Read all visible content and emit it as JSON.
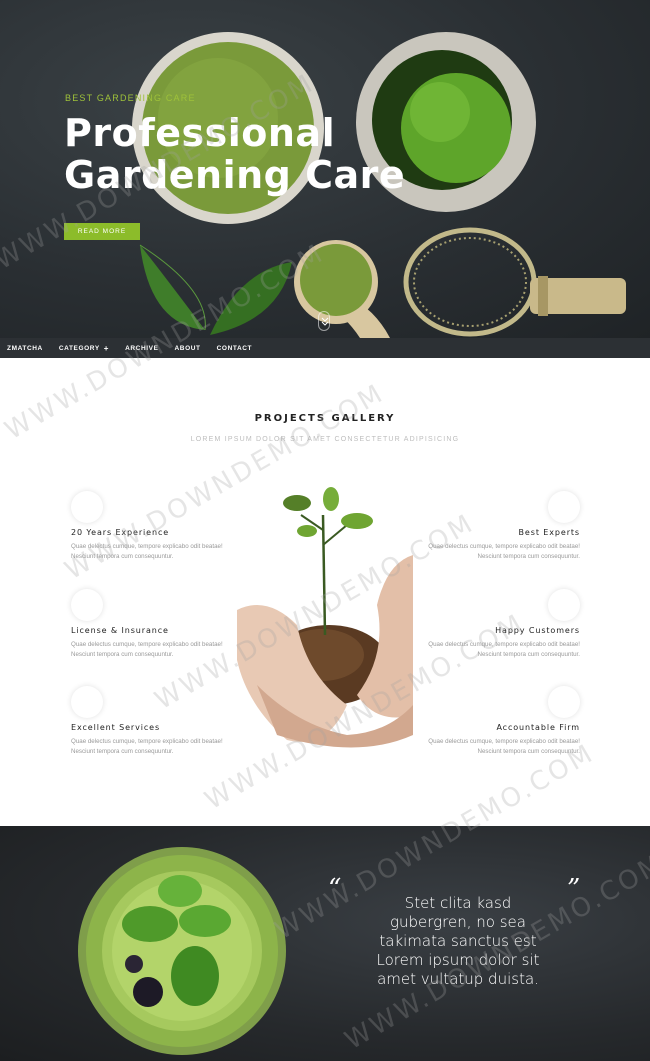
{
  "hero": {
    "kicker": "BEST GARDENING CARE",
    "title": "Professional Gardening Care",
    "button_label": "READ MORE"
  },
  "nav": {
    "items": [
      "ZMATCHA",
      "CATEGORY",
      "ARCHIVE",
      "ABOUT",
      "CONTACT"
    ],
    "category_expand": "+"
  },
  "gallery": {
    "title": "PROJECTS GALLERY",
    "subtitle": "LOREM IPSUM DOLOR SIT AMET CONSECTETUR ADIPISICING",
    "features_left": [
      {
        "title": "20 Years Experience",
        "text": "Quae delectus cumque, tempore explicabo odit beatae! Nesciunt tempora cum consequuntur."
      },
      {
        "title": "License & Insurance",
        "text": "Quae delectus cumque, tempore explicabo odit beatae! Nesciunt tempora cum consequuntur."
      },
      {
        "title": "Excellent Services",
        "text": "Quae delectus cumque, tempore explicabo odit beatae! Nesciunt tempora cum consequuntur."
      }
    ],
    "features_right": [
      {
        "title": "Best Experts",
        "text": "Quae delectus cumque, tempore explicabo odit beatae! Nesciunt tempora cum consequuntur."
      },
      {
        "title": "Happy Customers",
        "text": "Quae delectus cumque, tempore explicabo odit beatae! Nesciunt tempora cum consequuntur."
      },
      {
        "title": "Accountable Firm",
        "text": "Quae delectus cumque, tempore explicabo odit beatae! Nesciunt tempora cum consequuntur."
      }
    ]
  },
  "testimonial": {
    "open_quote": "“",
    "close_quote": "”",
    "text": "Stet clita kasd gubergren, no sea takimata sanctus est Lorem ipsum dolor sit amet vultatup duista."
  },
  "watermark": "WWW.DOWNDEMO.COM",
  "colors": {
    "accent": "#8cbc2a",
    "nav_bg": "#2c3034",
    "hero_bg": "#2a2f33"
  }
}
